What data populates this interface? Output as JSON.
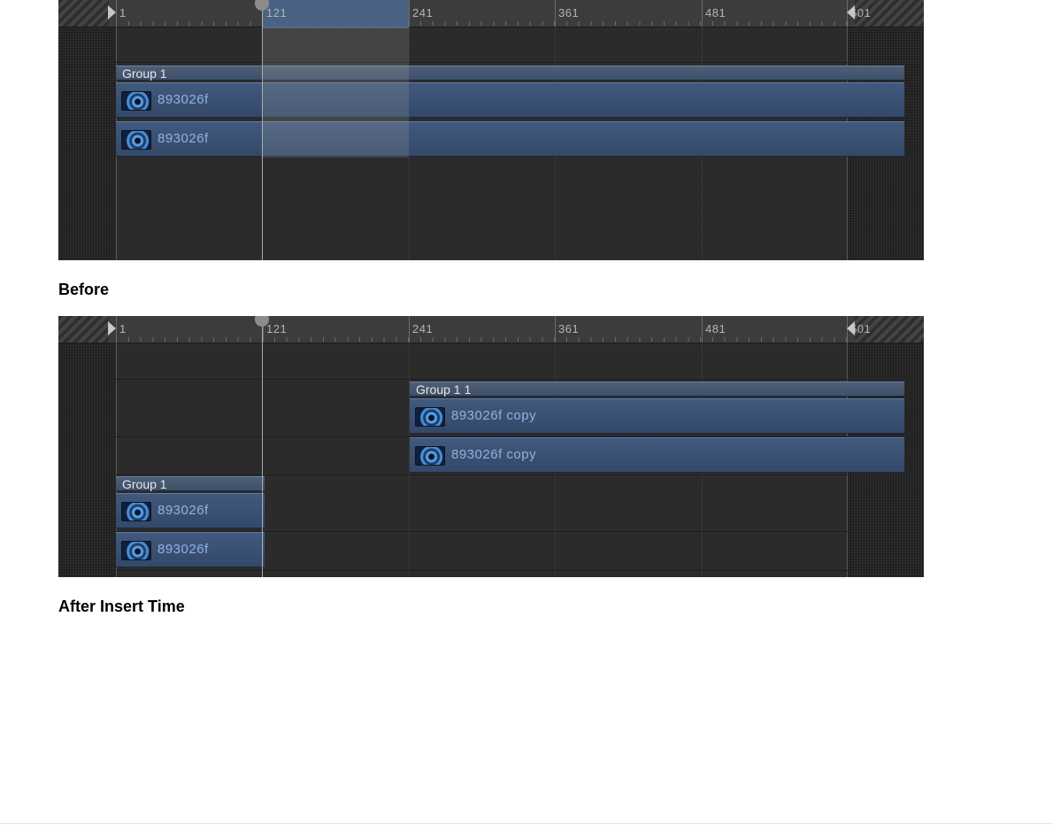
{
  "ruler": {
    "labels": [
      "1",
      "121",
      "241",
      "361",
      "481",
      "601"
    ]
  },
  "before": {
    "group_label": "Group 1",
    "layers": [
      "893026f",
      "893026f"
    ],
    "caption": "Before"
  },
  "after": {
    "copy_group_label": "Group 1 1",
    "copy_layers": [
      "893026f copy",
      "893026f copy"
    ],
    "group_label": "Group 1",
    "layers": [
      "893026f",
      "893026f"
    ],
    "caption": "After Insert Time"
  },
  "colors": {
    "timeline_bg": "#2b2b2b",
    "group_bar": "#46597a",
    "layer_bar": "#3a5175",
    "layer_text": "#8fb2e0"
  }
}
